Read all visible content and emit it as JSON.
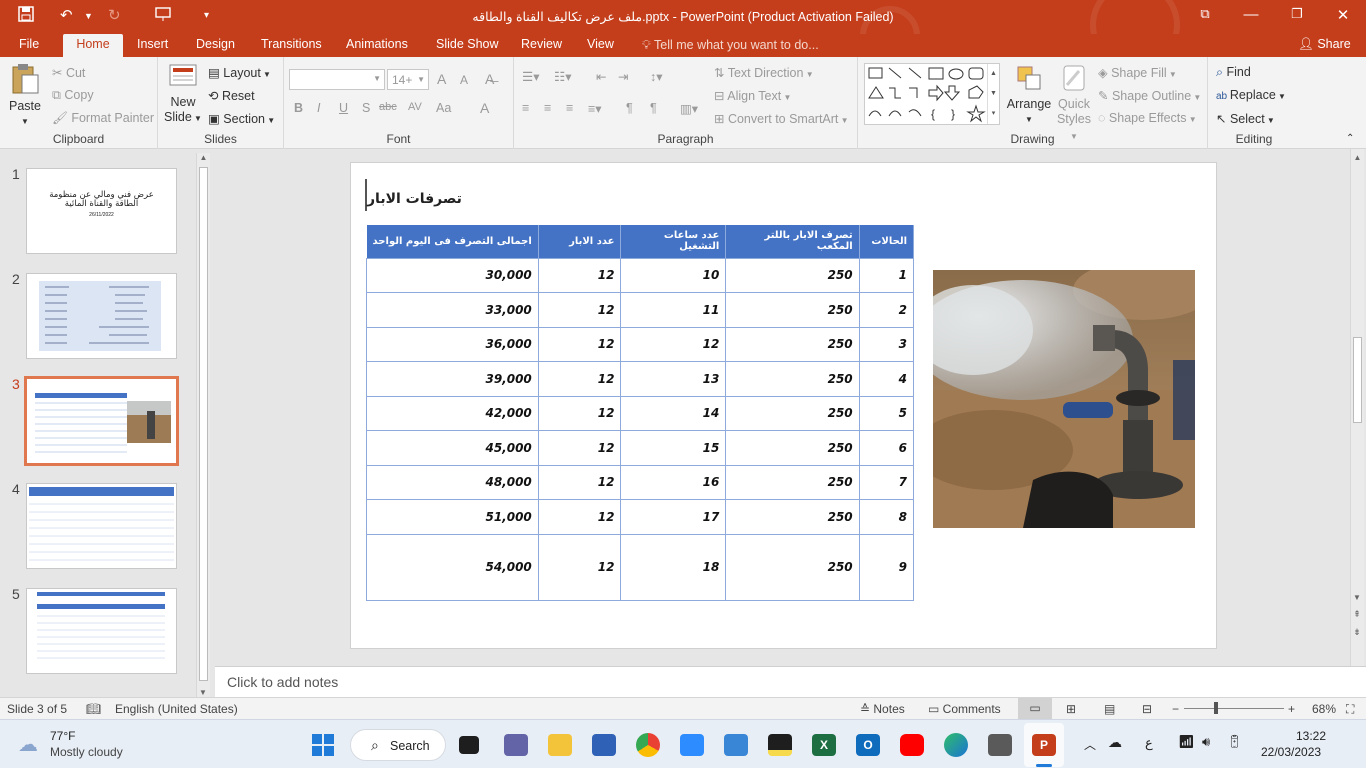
{
  "window": {
    "title": "ملف عرض تكاليف القناة والطاقه.pptx - PowerPoint (Product Activation Failed)"
  },
  "tabs": [
    "File",
    "Home",
    "Insert",
    "Design",
    "Transitions",
    "Animations",
    "Slide Show",
    "Review",
    "View"
  ],
  "tell_me": "Tell me what you want to do...",
  "share": "Share",
  "ribbon": {
    "clipboard": {
      "paste": "Paste",
      "cut": "Cut",
      "copy": "Copy",
      "format_painter": "Format Painter",
      "label": "Clipboard"
    },
    "slides": {
      "new_slide_1": "New",
      "new_slide_2": "Slide",
      "layout": "Layout",
      "reset": "Reset",
      "section": "Section",
      "label": "Slides"
    },
    "font": {
      "size": "14+",
      "bold": "B",
      "italic": "I",
      "underline": "U",
      "shadow": "S",
      "strike": "abc",
      "spacing": "AV",
      "case": "Aa",
      "color": "A",
      "grow": "A",
      "shrink": "A",
      "label": "Font"
    },
    "paragraph": {
      "text_direction": "Text Direction",
      "align_text": "Align Text",
      "smartart": "Convert to SmartArt",
      "label": "Paragraph"
    },
    "drawing": {
      "arrange": "Arrange",
      "quick_styles_1": "Quick",
      "quick_styles_2": "Styles",
      "shape_fill": "Shape Fill",
      "shape_outline": "Shape Outline",
      "shape_effects": "Shape Effects",
      "label": "Drawing"
    },
    "editing": {
      "find": "Find",
      "replace": "Replace",
      "select": "Select",
      "label": "Editing"
    }
  },
  "thumbnails": [
    {
      "num": "1",
      "title": "عرض فني ومالي عن منظومة الطاقة والقناة المائية",
      "date": "26/11/2022"
    },
    {
      "num": "2"
    },
    {
      "num": "3"
    },
    {
      "num": "4"
    },
    {
      "num": "5"
    }
  ],
  "slide": {
    "title": "تصرفات الابار",
    "headers": [
      "الحالات",
      "تصرف الابار باللتر المكعب",
      "عدد ساعات التشغيل",
      "عدد الابار",
      "اجمالى التصرف فى اليوم الواحد"
    ],
    "rows": [
      [
        "1",
        "250",
        "10",
        "12",
        "30,000"
      ],
      [
        "2",
        "250",
        "11",
        "12",
        "33,000"
      ],
      [
        "3",
        "250",
        "12",
        "12",
        "36,000"
      ],
      [
        "4",
        "250",
        "13",
        "12",
        "39,000"
      ],
      [
        "5",
        "250",
        "14",
        "12",
        "42,000"
      ],
      [
        "6",
        "250",
        "15",
        "12",
        "45,000"
      ],
      [
        "7",
        "250",
        "16",
        "12",
        "48,000"
      ],
      [
        "8",
        "250",
        "17",
        "12",
        "51,000"
      ],
      [
        "9",
        "250",
        "18",
        "12",
        "54,000"
      ]
    ]
  },
  "notes_placeholder": "Click to add notes",
  "status": {
    "slide": "Slide 3 of 5",
    "language": "English (United States)",
    "notes": "Notes",
    "comments": "Comments",
    "zoom": "68%"
  },
  "taskbar": {
    "temp": "77°F",
    "weather": "Mostly cloudy",
    "search": "Search",
    "time": "13:22",
    "date": "22/03/2023",
    "lang": "ع"
  },
  "colors": {
    "accent": "#c43e1c",
    "table_header": "#4472c4",
    "table_border": "#8ea9db",
    "selected_thumb": "#e0784f"
  }
}
